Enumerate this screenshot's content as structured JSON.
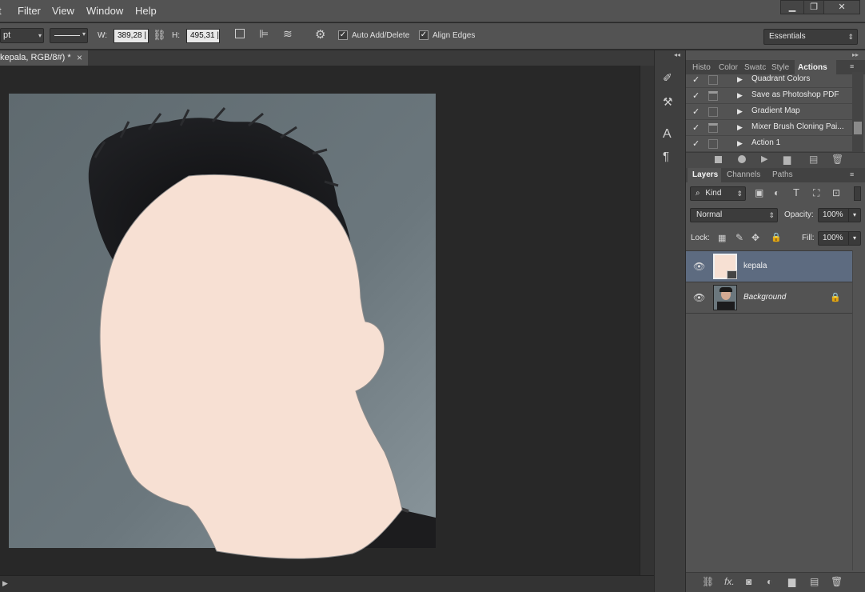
{
  "menubar": {
    "items": [
      "t",
      "Filter",
      "View",
      "Window",
      "Help"
    ],
    "window_controls": {
      "minimize": "▁",
      "restore": "❐",
      "close": "✕"
    }
  },
  "options": {
    "unit_value": "pt",
    "w_label": "W:",
    "w_value": "389,28 |",
    "h_label": "H:",
    "h_value": "495,31 |",
    "auto_add_delete": "Auto Add/Delete",
    "auto_add_delete_checked": true,
    "align_edges": "Align Edges",
    "align_edges_checked": true,
    "workspace": "Essentials"
  },
  "document": {
    "tab_title": "kepala, RGB/8#) *",
    "close": "×"
  },
  "actions_panel": {
    "tabs": [
      "Histo",
      "Color",
      "Swatc",
      "Style",
      "Actions"
    ],
    "active_tab": "Actions",
    "items": [
      {
        "label": "Quadrant Colors",
        "checked": true,
        "dialog": false
      },
      {
        "label": "Save as Photoshop PDF",
        "checked": true,
        "dialog": true
      },
      {
        "label": "Gradient Map",
        "checked": true,
        "dialog": false
      },
      {
        "label": "Mixer Brush Cloning Pai...",
        "checked": true,
        "dialog": true
      },
      {
        "label": "Action 1",
        "checked": true,
        "dialog": false
      }
    ]
  },
  "layers_panel": {
    "tabs": [
      "Layers",
      "Channels",
      "Paths"
    ],
    "active_tab": "Layers",
    "filter_kind": "Kind",
    "blend_mode": "Normal",
    "opacity_label": "Opacity:",
    "opacity_value": "100%",
    "lock_label": "Lock:",
    "fill_label": "Fill:",
    "fill_value": "100%",
    "layers": [
      {
        "name": "kepala",
        "visible": true,
        "selected": true,
        "locked": false
      },
      {
        "name": "Background",
        "visible": true,
        "selected": false,
        "locked": true
      }
    ]
  },
  "colors": {
    "face_fill": "#f7e0d3",
    "selected_layer": "#5d6b80",
    "panel_bg": "#535353"
  }
}
